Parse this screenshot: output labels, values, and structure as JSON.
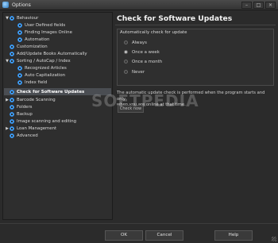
{
  "window": {
    "title": "Options",
    "minimize": "–",
    "maximize": "□",
    "close": "×"
  },
  "tree": {
    "items": [
      {
        "label": "Behaviour",
        "arrow": "▼"
      },
      {
        "label": "User Defined fields"
      },
      {
        "label": "Finding Images Online"
      },
      {
        "label": "Automation"
      },
      {
        "label": "Customization"
      },
      {
        "label": "Add/Update Books Automatically"
      },
      {
        "label": "Sorting / AutoCap / Index",
        "arrow": "▼"
      },
      {
        "label": "Recognized Articles"
      },
      {
        "label": "Auto Capitalization"
      },
      {
        "label": "Index field"
      },
      {
        "label": "Check for Software Updates"
      },
      {
        "label": "Barcode Scanning",
        "arrow": "▶"
      },
      {
        "label": "Folders"
      },
      {
        "label": "Backup"
      },
      {
        "label": "Image scanning and editing"
      },
      {
        "label": "Loan Management",
        "arrow": "▶"
      },
      {
        "label": "Advanced"
      }
    ]
  },
  "main": {
    "title": "Check for Software Updates",
    "group_title": "Automatically check for update",
    "options": [
      {
        "label": "Always",
        "selected": false
      },
      {
        "label": "Once a week",
        "selected": true
      },
      {
        "label": "Once a month",
        "selected": false
      },
      {
        "label": "Never",
        "selected": false
      }
    ],
    "description_line1": "The automatic update check is performed when the program starts and only",
    "description_line2": "when you are online at that time.",
    "check_now_label": "Check now"
  },
  "watermark": "SOFTPEDIA",
  "buttons": {
    "ok": "OK",
    "cancel": "Cancel",
    "help": "Help"
  },
  "colors": {
    "accent": "#47a8ff",
    "selected_row": "#4a4d52"
  }
}
